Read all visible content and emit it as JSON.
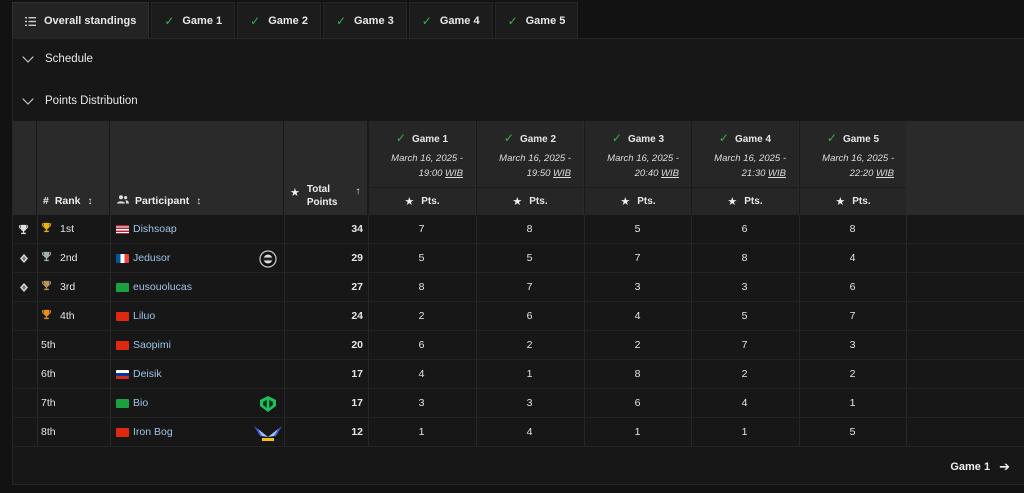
{
  "tabs": [
    {
      "label": "Overall standings",
      "icon": "list-ordered-icon",
      "active": true
    },
    {
      "label": "Game 1",
      "icon": "check-icon"
    },
    {
      "label": "Game 2",
      "icon": "check-icon"
    },
    {
      "label": "Game 3",
      "icon": "check-icon"
    },
    {
      "label": "Game 4",
      "icon": "check-icon"
    },
    {
      "label": "Game 5",
      "icon": "check-icon"
    }
  ],
  "sections": {
    "schedule": "Schedule",
    "points_distribution": "Points Distribution"
  },
  "table": {
    "headers": {
      "rank": "Rank",
      "participant": "Participant",
      "total_points_line1": "Total",
      "total_points_line2": "Points",
      "points": "Pts."
    },
    "games": [
      {
        "label": "Game 1",
        "date": "March 16, 2025 -",
        "time": "19:00",
        "tz": "WIB"
      },
      {
        "label": "Game 2",
        "date": "March 16, 2025 -",
        "time": "19:50",
        "tz": "WIB"
      },
      {
        "label": "Game 3",
        "date": "March 16, 2025 -",
        "time": "20:40",
        "tz": "WIB"
      },
      {
        "label": "Game 4",
        "date": "March 16, 2025 -",
        "time": "21:30",
        "tz": "WIB"
      },
      {
        "label": "Game 5",
        "date": "March 16, 2025 -",
        "time": "22:20",
        "tz": "WIB"
      }
    ],
    "rows": [
      {
        "status_icon": "trophy-icon",
        "rank": "1st",
        "rank_icon": "gold-trophy-icon",
        "flag": "us-flag-icon",
        "name": "Dishsoap",
        "team_logo": "",
        "total": "34",
        "scores": [
          "7",
          "8",
          "5",
          "6",
          "8"
        ]
      },
      {
        "status_icon": "diamond-icon",
        "rank": "2nd",
        "rank_icon": "silver-trophy-icon",
        "flag": "fr-flag-icon",
        "name": "Jedusor",
        "team_logo": "team-badge-icon",
        "total": "29",
        "scores": [
          "5",
          "5",
          "7",
          "8",
          "4"
        ]
      },
      {
        "status_icon": "diamond-icon",
        "rank": "3rd",
        "rank_icon": "bronze-trophy-icon",
        "flag": "br-flag-icon",
        "name": "eusouolucas",
        "team_logo": "",
        "total": "27",
        "scores": [
          "8",
          "7",
          "3",
          "3",
          "6"
        ]
      },
      {
        "status_icon": "",
        "rank": "4th",
        "rank_icon": "orange-trophy-icon",
        "flag": "cn-flag-icon",
        "name": "Liluo",
        "team_logo": "",
        "total": "24",
        "scores": [
          "2",
          "6",
          "4",
          "5",
          "7"
        ]
      },
      {
        "status_icon": "",
        "rank": "5th",
        "rank_icon": "",
        "flag": "cn-flag-icon",
        "name": "Saopimi",
        "team_logo": "",
        "total": "20",
        "scores": [
          "6",
          "2",
          "2",
          "7",
          "3"
        ]
      },
      {
        "status_icon": "",
        "rank": "6th",
        "rank_icon": "",
        "flag": "ru-flag-icon",
        "name": "Deisik",
        "team_logo": "",
        "total": "17",
        "scores": [
          "4",
          "1",
          "8",
          "2",
          "2"
        ]
      },
      {
        "status_icon": "",
        "rank": "7th",
        "rank_icon": "",
        "flag": "br-flag-icon",
        "name": "Bio",
        "team_logo": "green-team-logo-icon",
        "total": "17",
        "scores": [
          "3",
          "3",
          "6",
          "4",
          "1"
        ]
      },
      {
        "status_icon": "",
        "rank": "8th",
        "rank_icon": "",
        "flag": "hk-flag-icon",
        "name": "Iron Bog",
        "team_logo": "blue-wings-logo-icon",
        "total": "12",
        "scores": [
          "1",
          "4",
          "1",
          "1",
          "5"
        ]
      }
    ]
  },
  "footer": {
    "next_label": "Game 1",
    "next_icon": "arrow-right-icon"
  },
  "colors": {
    "check": "#37b24d",
    "gold": "#e7b512",
    "silver": "#9fb0b3",
    "bronze": "#b8935a",
    "orange": "#e6911f",
    "link": "#9fc3e8"
  }
}
